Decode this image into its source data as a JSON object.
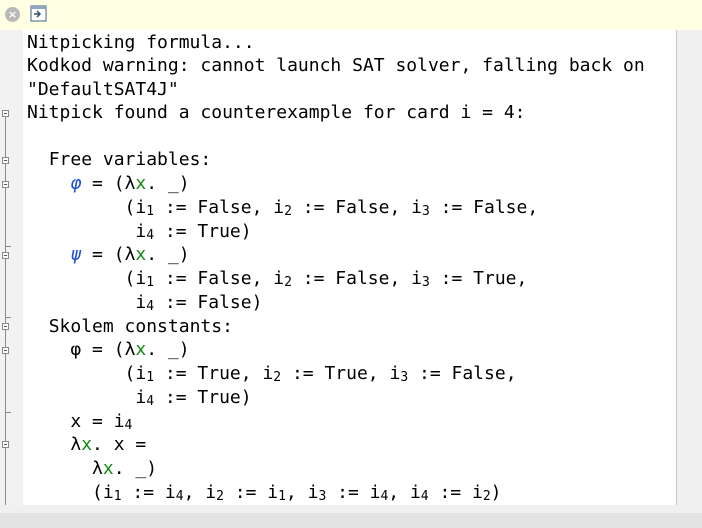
{
  "toolbar": {
    "close_icon": "close-icon",
    "detach_icon": "detach-icon",
    "close_glyph": "×"
  },
  "output": {
    "line1": "Nitpicking formula...",
    "line2": "Kodkod warning: cannot launch SAT solver, falling back on",
    "line3": "\"DefaultSAT4J\"",
    "line4": "Nitpick found a counterexample for card i = 4:",
    "free_vars_header": "Free variables:",
    "skolem_header": "Skolem constants:",
    "phi": "φ",
    "psi": "ψ",
    "lambda": "λ",
    "x": "x",
    "eq_open": " = (",
    "dot_under": ". _)",
    "fv_phi_1a": "(i",
    "fv_phi_1b": " := False, i",
    "fv_phi_1c": " := False, i",
    "fv_phi_1d": " := False,",
    "fv_phi_2a": "i",
    "fv_phi_2b": " := True)",
    "fv_psi_1d": " := True,",
    "fv_psi_2b": " := False)",
    "sk_phi_1b": " := True, i",
    "sk_phi_1c": " := True, i",
    "sk_phi_1d": " := False,",
    "sk_phi_2b": " := True)",
    "x_eq": "x = i",
    "lam_x_eq": ". x =",
    "last_a": "(i",
    "last_b": " := i",
    "last_c": ", i",
    "last_d": " := i",
    "last_e": ", i",
    "last_f": " := i",
    "last_g": ", i",
    "last_h": " := i",
    "last_i": ")",
    "s1": "1",
    "s2": "2",
    "s3": "3",
    "s4": "4"
  },
  "colors": {
    "variable_blue": "#1e4fd9",
    "bound_green": "#138a13",
    "toolbar_bg": "#ffffe3",
    "text": "#000000"
  }
}
